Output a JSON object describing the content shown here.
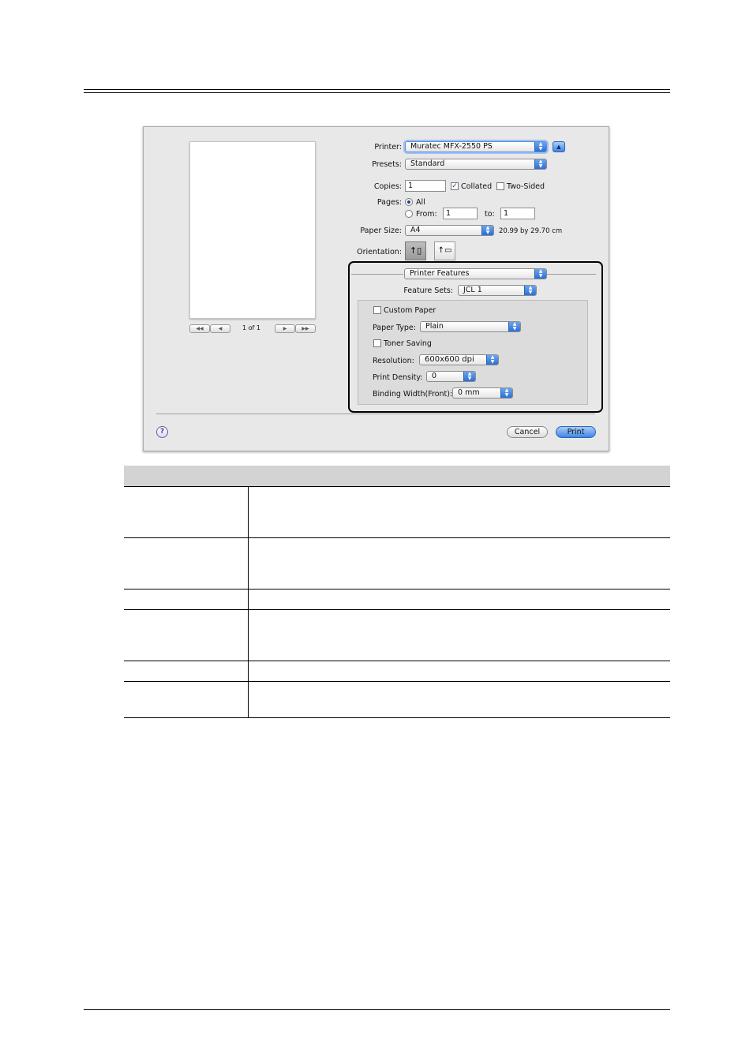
{
  "dialog": {
    "printer": {
      "label": "Printer:",
      "value": "Muratec MFX-2550 PS"
    },
    "presets": {
      "label": "Presets:",
      "value": "Standard"
    },
    "copies": {
      "label": "Copies:",
      "value": "1",
      "collated_label": "Collated",
      "collated_checked": true,
      "two_sided_label": "Two-Sided",
      "two_sided_checked": false
    },
    "pages": {
      "label": "Pages:",
      "all_label": "All",
      "from_label": "From:",
      "from_value": "1",
      "to_label": "to:",
      "to_value": "1"
    },
    "paper_size": {
      "label": "Paper Size:",
      "value": "A4",
      "dimensions": "20.99 by 29.70 cm"
    },
    "orientation": {
      "label": "Orientation:"
    },
    "preview": {
      "page_indicator": "1 of 1"
    },
    "section_popup": "Printer Features",
    "feature_sets": {
      "label": "Feature Sets:",
      "value": "JCL 1"
    },
    "features": {
      "custom_paper_label": "Custom Paper",
      "paper_type": {
        "label": "Paper Type:",
        "value": "Plain"
      },
      "toner_saving_label": "Toner Saving",
      "resolution": {
        "label": "Resolution:",
        "value": "600x600 dpi"
      },
      "print_density": {
        "label": "Print Density:",
        "value": "0"
      },
      "binding_width": {
        "label": "Binding Width(Front):",
        "value": "0 mm"
      }
    },
    "help_symbol": "?",
    "cancel_label": "Cancel",
    "print_label": "Print"
  },
  "colors": {
    "accent": "#3f86e3",
    "table_header": "#d3d3d3",
    "highlight_border": "#000000"
  }
}
